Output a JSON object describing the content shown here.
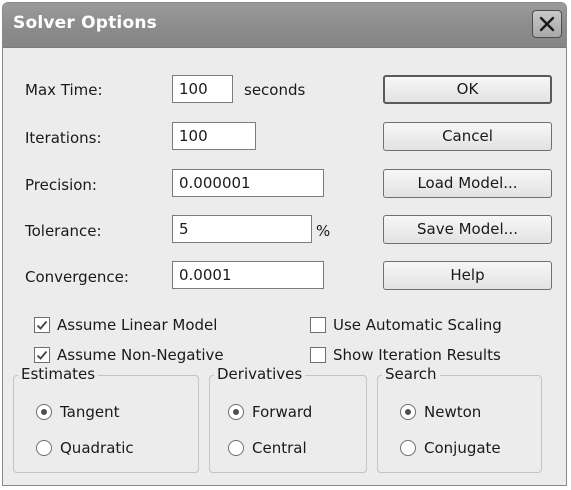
{
  "window": {
    "title": "Solver Options",
    "close_icon": "close-icon"
  },
  "fields": {
    "max_time": {
      "label": "Max Time:",
      "value": "100",
      "unit": "seconds"
    },
    "iterations": {
      "label": "Iterations:",
      "value": "100"
    },
    "precision": {
      "label": "Precision:",
      "value": "0.000001"
    },
    "tolerance": {
      "label": "Tolerance:",
      "value": "5",
      "unit": "%"
    },
    "convergence": {
      "label": "Convergence:",
      "value": "0.0001"
    }
  },
  "buttons": {
    "ok": "OK",
    "cancel": "Cancel",
    "load_model": "Load Model...",
    "save_model": "Save Model...",
    "help": "Help"
  },
  "checkboxes": {
    "assume_linear_model": {
      "label": "Assume Linear Model",
      "checked": true
    },
    "use_automatic_scaling": {
      "label": "Use Automatic Scaling",
      "checked": false
    },
    "assume_non_negative": {
      "label": "Assume Non-Negative",
      "checked": true
    },
    "show_iteration_results": {
      "label": "Show Iteration Results",
      "checked": false
    }
  },
  "groups": {
    "estimates": {
      "title": "Estimates",
      "options": [
        {
          "label": "Tangent",
          "selected": true
        },
        {
          "label": "Quadratic",
          "selected": false
        }
      ]
    },
    "derivatives": {
      "title": "Derivatives",
      "options": [
        {
          "label": "Forward",
          "selected": true
        },
        {
          "label": "Central",
          "selected": false
        }
      ]
    },
    "search": {
      "title": "Search",
      "options": [
        {
          "label": "Newton",
          "selected": true
        },
        {
          "label": "Conjugate",
          "selected": false
        }
      ]
    }
  },
  "colors": {
    "titlebar": "#8c8c8c",
    "dialog_bg": "#ececec",
    "title_text": "#ffffff"
  }
}
